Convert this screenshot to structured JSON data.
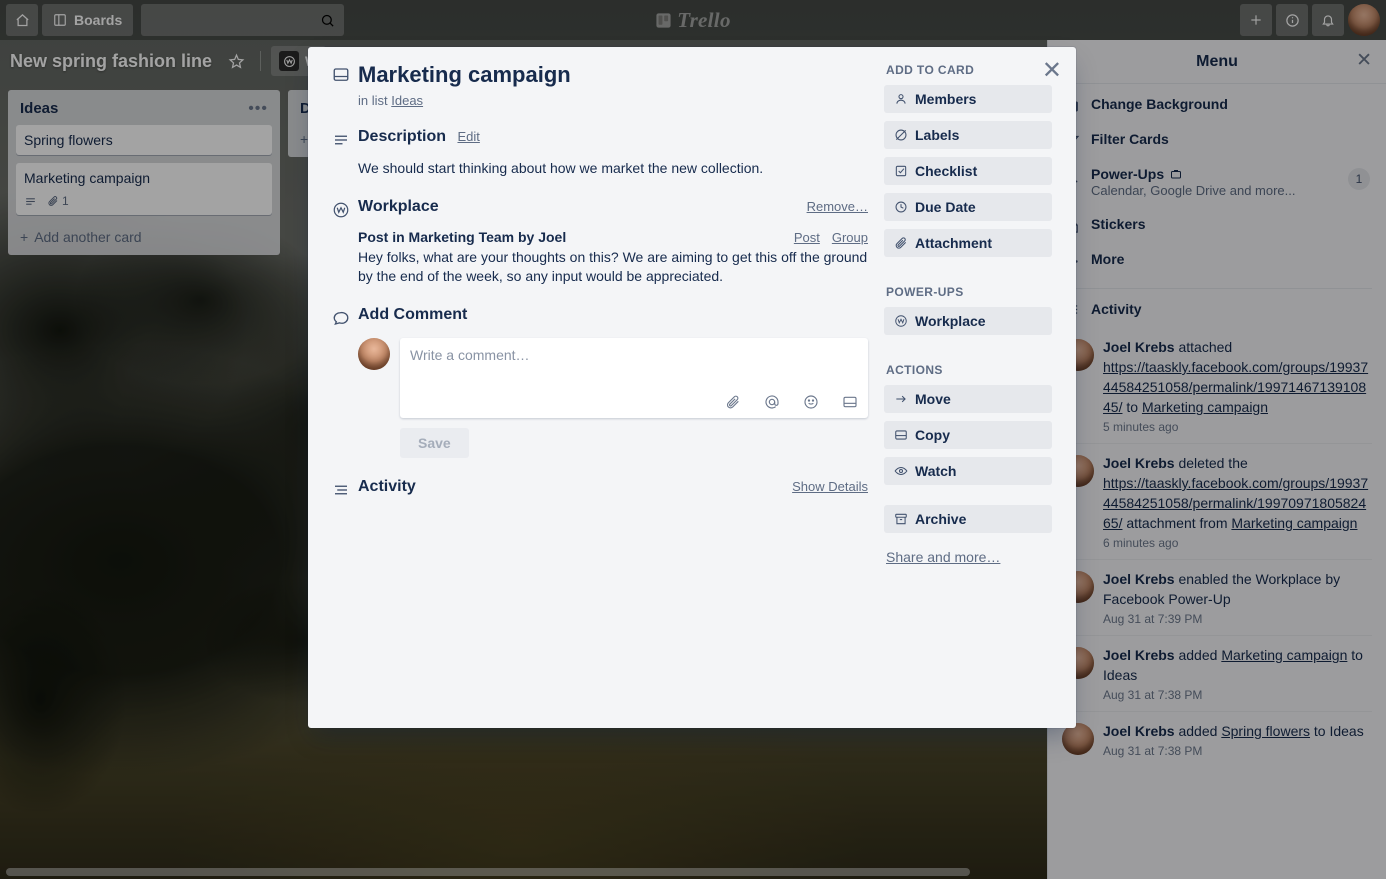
{
  "topbar": {
    "home_icon": "home-icon",
    "boards_label": "Boards",
    "boards_icon": "boards-icon",
    "search_placeholder": "",
    "search_icon": "search-icon",
    "logo_text": "Trello",
    "logo_icon": "trello-logo-icon",
    "add_icon": "plus-icon",
    "info_icon": "info-icon",
    "notifications_icon": "bell-icon",
    "avatar": "user-avatar"
  },
  "board_header": {
    "title": "New spring fashion line",
    "star_icon": "star-icon",
    "workplace_badge": "W",
    "workplace_label": "W"
  },
  "board": {
    "lists": [
      {
        "title": "Ideas",
        "menu_icon": "list-menu-icon",
        "add_card_label": "Add another card",
        "cards": [
          {
            "title": "Spring flowers",
            "badges": []
          },
          {
            "title": "Marketing campaign",
            "badges": [
              {
                "icon": "description-icon",
                "value": ""
              },
              {
                "icon": "attachment-icon",
                "value": "1"
              }
            ]
          }
        ]
      },
      {
        "title": "D",
        "menu_icon": "list-menu-icon",
        "add_card_label": "",
        "cards": []
      }
    ]
  },
  "modal": {
    "close_icon": "close-icon",
    "card_icon": "card-icon",
    "title": "Marketing campaign",
    "in_list_prefix": "in list",
    "in_list_name": "Ideas",
    "description": {
      "icon": "description-icon",
      "title": "Description",
      "edit_label": "Edit",
      "text": "We should start thinking about how we market the new collection."
    },
    "workplace": {
      "icon": "workplace-icon",
      "title": "Workplace",
      "remove_label": "Remove…",
      "post_title": "Post in Marketing Team by Joel",
      "post_link": "Post",
      "group_link": "Group",
      "post_body": "Hey folks, what are your thoughts on this? We are aiming to get this off the ground by the end of the week, so any input would be appreciated."
    },
    "comment": {
      "icon": "comment-icon",
      "title": "Add Comment",
      "placeholder": "Write a comment…",
      "value": "",
      "save_label": "Save",
      "tools": [
        {
          "icon": "attachment-icon"
        },
        {
          "icon": "mention-icon"
        },
        {
          "icon": "emoji-icon"
        },
        {
          "icon": "card-icon"
        }
      ]
    },
    "activity": {
      "icon": "activity-icon",
      "title": "Activity",
      "show_details_label": "Show Details"
    },
    "sidebar": {
      "add_to_card_heading": "ADD TO CARD",
      "add_to_card": [
        {
          "label": "Members",
          "icon": "member-icon"
        },
        {
          "label": "Labels",
          "icon": "label-icon"
        },
        {
          "label": "Checklist",
          "icon": "checklist-icon"
        },
        {
          "label": "Due Date",
          "icon": "clock-icon"
        },
        {
          "label": "Attachment",
          "icon": "attachment-icon"
        }
      ],
      "powerups_heading": "POWER-UPS",
      "powerups": [
        {
          "label": "Workplace",
          "icon": "workplace-icon"
        }
      ],
      "actions_heading": "ACTIONS",
      "actions": [
        {
          "label": "Move",
          "icon": "arrow-right-icon"
        },
        {
          "label": "Copy",
          "icon": "card-icon"
        },
        {
          "label": "Watch",
          "icon": "eye-icon"
        }
      ],
      "archive": {
        "label": "Archive",
        "icon": "archive-icon"
      },
      "share_label": "Share and more…"
    }
  },
  "menu": {
    "title": "Menu",
    "back_icon": "chevron-left-icon",
    "close_icon": "close-icon",
    "items": [
      {
        "label": "Change Background",
        "icon": "background-icon",
        "sub": "",
        "count": ""
      },
      {
        "label": "Filter Cards",
        "icon": "filter-icon",
        "sub": "",
        "count": ""
      },
      {
        "label": "Power-Ups",
        "icon": "powerup-icon",
        "badge_icon": "briefcase-icon",
        "sub": "Calendar, Google Drive and more...",
        "count": "1"
      },
      {
        "label": "Stickers",
        "icon": "sticker-icon",
        "sub": "",
        "count": ""
      },
      {
        "label": "More",
        "icon": "more-icon",
        "sub": "",
        "count": ""
      }
    ],
    "activity_heading": "Activity",
    "activity_icon": "activity-icon",
    "activities": [
      {
        "user": "Joel Krebs",
        "segments": [
          {
            "text": " attached ",
            "link": false
          },
          {
            "text": "https://taaskly.facebook.com/groups/1993744584251058/permalink/1997146713910845/",
            "link": true
          },
          {
            "text": " to ",
            "link": false
          },
          {
            "text": "Marketing campaign",
            "link": true
          }
        ],
        "time": "5 minutes ago"
      },
      {
        "user": "Joel Krebs",
        "segments": [
          {
            "text": " deleted the ",
            "link": false
          },
          {
            "text": "https://taaskly.facebook.com/groups/1993744584251058/permalink/1997097180582465/",
            "link": true
          },
          {
            "text": " attachment from ",
            "link": false
          },
          {
            "text": "Marketing campaign",
            "link": true
          }
        ],
        "time": "6 minutes ago"
      },
      {
        "user": "Joel Krebs",
        "segments": [
          {
            "text": " enabled the Workplace by Facebook Power-Up",
            "link": false
          }
        ],
        "time": "Aug 31 at 7:39 PM"
      },
      {
        "user": "Joel Krebs",
        "segments": [
          {
            "text": " added ",
            "link": false
          },
          {
            "text": "Marketing campaign",
            "link": true
          },
          {
            "text": " to Ideas",
            "link": false
          }
        ],
        "time": "Aug 31 at 7:38 PM"
      },
      {
        "user": "Joel Krebs",
        "segments": [
          {
            "text": " added ",
            "link": false
          },
          {
            "text": "Spring flowers",
            "link": true
          },
          {
            "text": " to Ideas",
            "link": false
          }
        ],
        "time": "Aug 31 at 7:38 PM"
      }
    ]
  },
  "colors": {
    "modal_bg": "#f4f5f7",
    "text": "#172b4d",
    "muted": "#5e6c84",
    "button_bg": "rgba(9,30,66,.06)"
  }
}
